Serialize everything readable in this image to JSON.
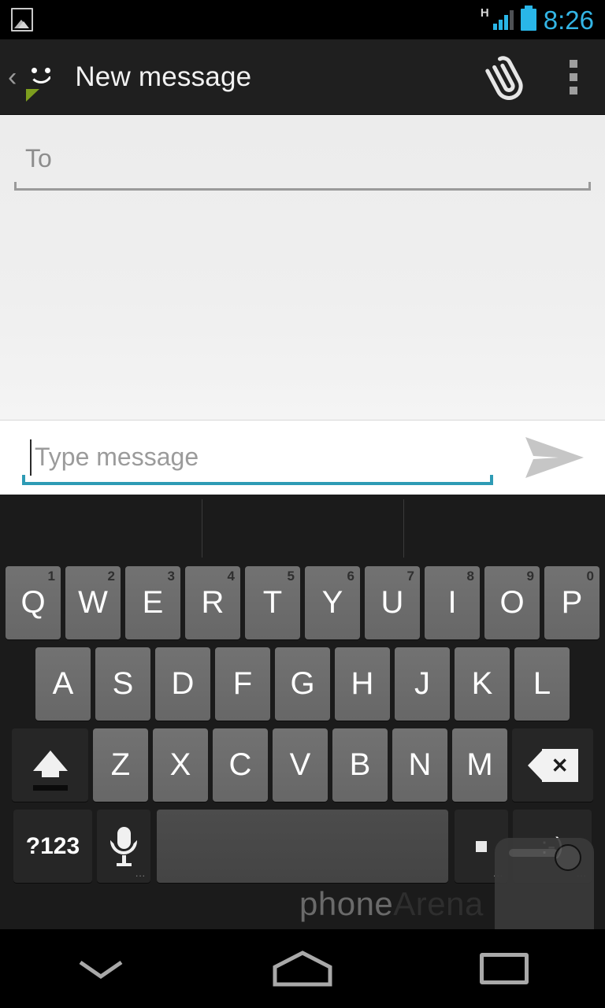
{
  "status_bar": {
    "left_icon": "picture-icon",
    "network_type": "H",
    "signal_bars": 3,
    "signal_total": 4,
    "battery_icon": "battery-full-icon",
    "time": "8:26",
    "accent_color": "#33b5e5"
  },
  "action_bar": {
    "back_label": "‹",
    "app_icon": "messaging-bubble-icon",
    "title": "New message",
    "attach_icon": "paperclip-icon",
    "overflow_icon": "overflow-menu-icon",
    "background_color": "#1f1f1f"
  },
  "compose": {
    "to_placeholder": "To",
    "to_value": "",
    "message_placeholder": "Type message",
    "message_value": "",
    "send_icon": "send-arrow-icon",
    "focus_color": "#2e9bb5"
  },
  "keyboard": {
    "suggestion_slots": [
      "",
      "",
      ""
    ],
    "row1": [
      {
        "label": "Q",
        "num": "1"
      },
      {
        "label": "W",
        "num": "2"
      },
      {
        "label": "E",
        "num": "3"
      },
      {
        "label": "R",
        "num": "4"
      },
      {
        "label": "T",
        "num": "5"
      },
      {
        "label": "Y",
        "num": "6"
      },
      {
        "label": "U",
        "num": "7"
      },
      {
        "label": "I",
        "num": "8"
      },
      {
        "label": "O",
        "num": "9"
      },
      {
        "label": "P",
        "num": "0"
      }
    ],
    "row2": [
      {
        "label": "A"
      },
      {
        "label": "S"
      },
      {
        "label": "D"
      },
      {
        "label": "F"
      },
      {
        "label": "G"
      },
      {
        "label": "H"
      },
      {
        "label": "J"
      },
      {
        "label": "K"
      },
      {
        "label": "L"
      }
    ],
    "row3": [
      {
        "label": "Z"
      },
      {
        "label": "X"
      },
      {
        "label": "C"
      },
      {
        "label": "V"
      },
      {
        "label": "B"
      },
      {
        "label": "N"
      },
      {
        "label": "M"
      }
    ],
    "shift_icon": "shift-arrow-icon",
    "backspace_icon": "backspace-icon",
    "symbols_label": "?123",
    "mic_icon": "microphone-icon",
    "space_label": "",
    "period_label": ".",
    "emoji_label": ":-)",
    "hint_dots": "...",
    "key_color": "#6b6b6b",
    "special_key_color": "#262626"
  },
  "nav_bar": {
    "back_icon": "keyboard-hide-chevron-icon",
    "home_icon": "home-pentagon-icon",
    "recents_icon": "recents-rectangle-icon"
  },
  "watermark": {
    "text_light": "phone",
    "text_dark": "Arena"
  }
}
